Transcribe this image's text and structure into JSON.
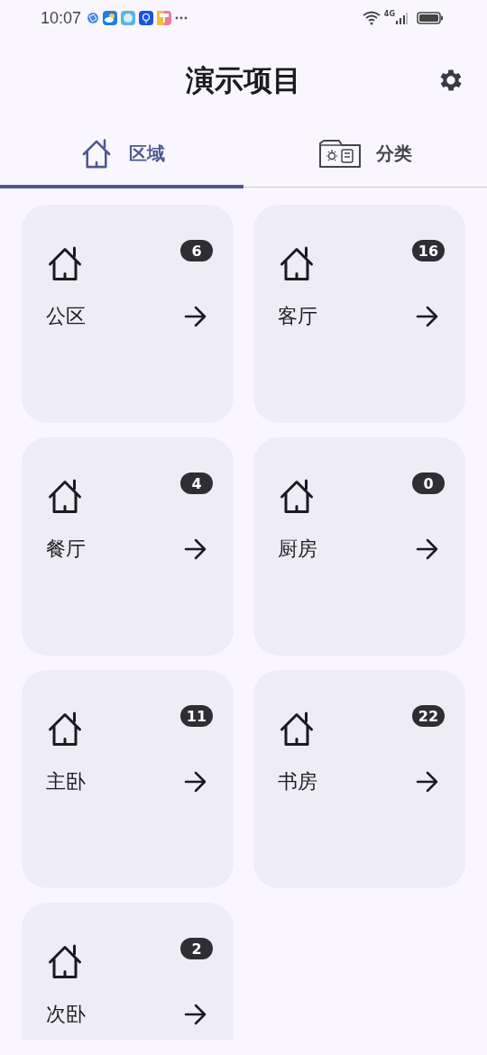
{
  "status_bar": {
    "time": "10:07",
    "network": "4G"
  },
  "header": {
    "title": "演示项目"
  },
  "tabs": [
    {
      "label": "区域",
      "kind": "house",
      "selected": true
    },
    {
      "label": "分类",
      "kind": "folder",
      "selected": false
    }
  ],
  "areas": [
    {
      "name": "公区",
      "count": "6"
    },
    {
      "name": "客厅",
      "count": "16"
    },
    {
      "name": "餐厅",
      "count": "4"
    },
    {
      "name": "厨房",
      "count": "0"
    },
    {
      "name": "主卧",
      "count": "11"
    },
    {
      "name": "书房",
      "count": "22"
    },
    {
      "name": "次卧",
      "count": "2"
    }
  ]
}
